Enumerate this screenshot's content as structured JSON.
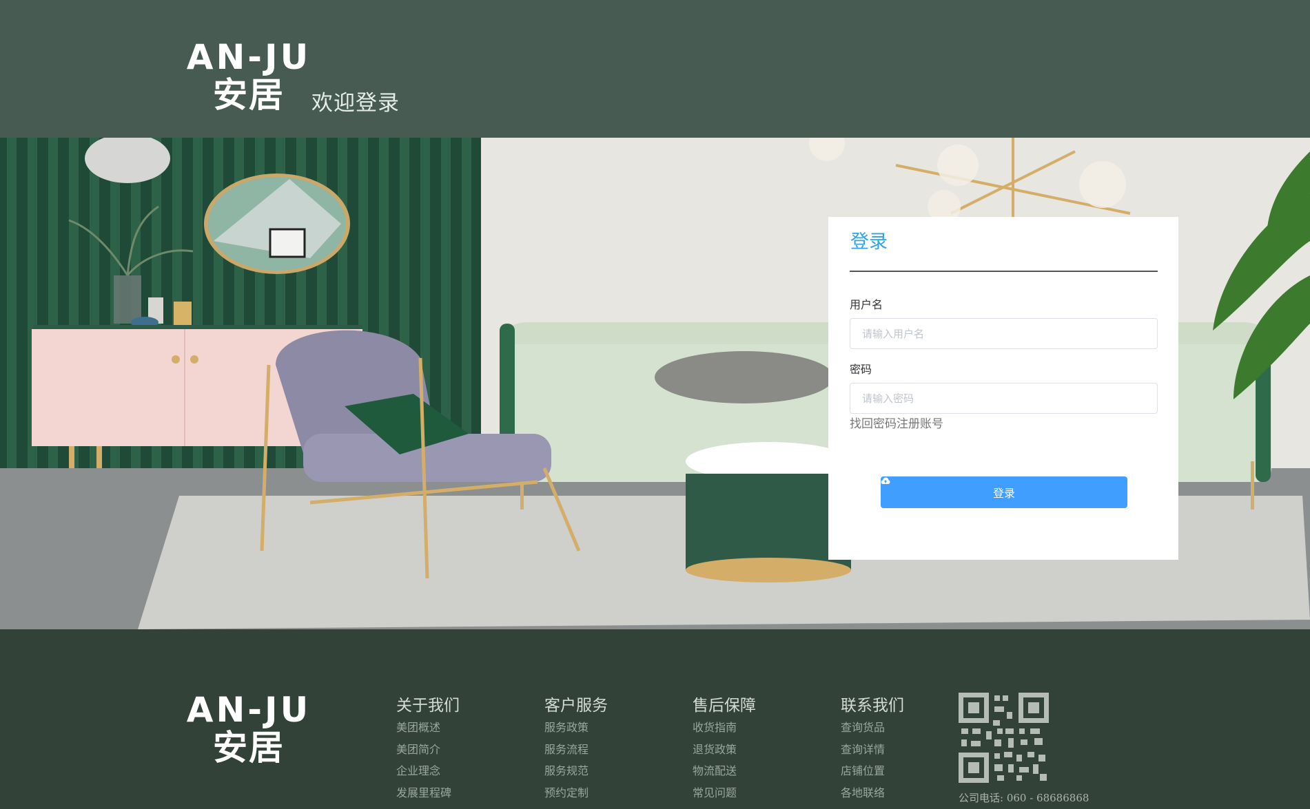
{
  "header": {
    "logo_en": "AN-JU",
    "logo_cn": "安居",
    "welcome": "欢迎登录"
  },
  "login": {
    "title": "登录",
    "username_label": "用户名",
    "username_placeholder": "请输入用户名",
    "password_label": "密码",
    "password_placeholder": "请输入密码",
    "forgot_link": "找回密码",
    "register_link": "注册账号",
    "submit_label": "登录",
    "submit_icon": "cloud-upload-icon"
  },
  "footer": {
    "logo_en": "AN-JU",
    "logo_cn": "安居",
    "columns": [
      {
        "title": "关于我们",
        "items": [
          "美团概述",
          "美团简介",
          "企业理念",
          "发展里程碑"
        ]
      },
      {
        "title": "客户服务",
        "items": [
          "服务政策",
          "服务流程",
          "服务规范",
          "预约定制"
        ]
      },
      {
        "title": "售后保障",
        "items": [
          "收货指南",
          "退货政策",
          "物流配送",
          "常见问题"
        ]
      },
      {
        "title": "联系我们",
        "items": [
          "查询货品",
          "查询详情",
          "店铺位置",
          "各地联络"
        ]
      }
    ],
    "phone": "公司电话: 060 - 68686868",
    "qr_icon": "qr-code-icon"
  },
  "colors": {
    "header_bg": "#475b52",
    "footer_bg": "#334239",
    "accent_blue": "#409eff",
    "title_blue": "#2fa3e6"
  }
}
